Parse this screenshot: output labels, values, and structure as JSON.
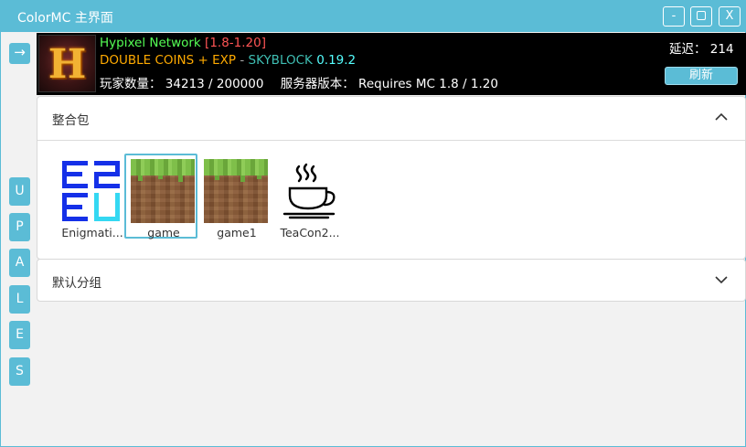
{
  "window": {
    "title": "ColorMC 主界面",
    "min_label": "-",
    "close_label": "X"
  },
  "sidebar": {
    "arrow_label": "→",
    "letters": [
      "U",
      "P",
      "A",
      "L",
      "E",
      "S"
    ]
  },
  "server": {
    "icon_letter": "H",
    "name": "Hypixel Network",
    "version_tag": "[1.8-1.20]",
    "motd_part1": "DOUBLE COINS + EXP",
    "motd_sep": " - ",
    "motd_part2": "SKYBLOCK",
    "motd_version": "0.19.2",
    "players_label": "玩家数量：",
    "players_online": "34213",
    "players_sep": "/",
    "players_max": "200000",
    "version_label": "服务器版本：",
    "version_value": "Requires MC 1.8 / 1.20",
    "ping_label": "延迟：",
    "ping_value": "214",
    "refresh_label": "刷新"
  },
  "groups": [
    {
      "title": "整合包",
      "expanded": true,
      "packs": [
        {
          "name": "Enigmati...",
          "icon": "enigmatica-icon",
          "selected": false
        },
        {
          "name": "game",
          "icon": "grass-block-icon",
          "selected": true
        },
        {
          "name": "game1",
          "icon": "grass-block-icon",
          "selected": false
        },
        {
          "name": "TeaCon2...",
          "icon": "tea-cup-icon",
          "selected": false
        }
      ]
    },
    {
      "title": "默认分组",
      "expanded": false,
      "packs": []
    }
  ],
  "colors": {
    "accent": "#5bbcd6",
    "server_bg": "#000000"
  }
}
